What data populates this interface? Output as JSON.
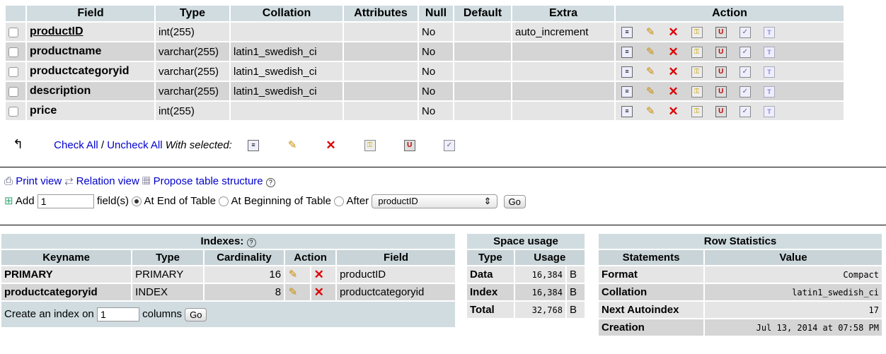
{
  "structure": {
    "headers": [
      "Field",
      "Type",
      "Collation",
      "Attributes",
      "Null",
      "Default",
      "Extra",
      "Action"
    ],
    "rows": [
      {
        "field": "productID",
        "type": "int(255)",
        "collation": "",
        "attributes": "",
        "null": "No",
        "default": "",
        "extra": "auto_increment"
      },
      {
        "field": "productname",
        "type": "varchar(255)",
        "collation": "latin1_swedish_ci",
        "attributes": "",
        "null": "No",
        "default": "",
        "extra": ""
      },
      {
        "field": "productcategoryid",
        "type": "varchar(255)",
        "collation": "latin1_swedish_ci",
        "attributes": "",
        "null": "No",
        "default": "",
        "extra": ""
      },
      {
        "field": "description",
        "type": "varchar(255)",
        "collation": "latin1_swedish_ci",
        "attributes": "",
        "null": "No",
        "default": "",
        "extra": ""
      },
      {
        "field": "price",
        "type": "int(255)",
        "collation": "",
        "attributes": "",
        "null": "No",
        "default": "",
        "extra": ""
      }
    ],
    "check_all": "Check All",
    "separator": "/",
    "uncheck_all": "Uncheck All",
    "with_selected": "With selected:"
  },
  "links": {
    "print_view": "Print view",
    "relation_view": "Relation view",
    "propose": "Propose table structure"
  },
  "add_field": {
    "add_label": "Add",
    "count": "1",
    "fields_label": "field(s)",
    "at_end": "At End of Table",
    "at_beginning": "At Beginning of Table",
    "after": "After",
    "after_select": "productID",
    "go": "Go"
  },
  "indexes": {
    "title": "Indexes:",
    "headers": [
      "Keyname",
      "Type",
      "Cardinality",
      "Action",
      "Field"
    ],
    "rows": [
      {
        "keyname": "PRIMARY",
        "type": "PRIMARY",
        "cardinality": "16",
        "field": "productID"
      },
      {
        "keyname": "productcategoryid",
        "type": "INDEX",
        "cardinality": "8",
        "field": "productcategoryid"
      }
    ],
    "create_prefix": "Create an index on",
    "create_count": "1",
    "create_suffix": "columns",
    "go": "Go"
  },
  "space": {
    "title": "Space usage",
    "headers": [
      "Type",
      "Usage"
    ],
    "rows": [
      {
        "type": "Data",
        "usage": "16,384",
        "unit": "B"
      },
      {
        "type": "Index",
        "usage": "16,384",
        "unit": "B"
      },
      {
        "type": "Total",
        "usage": "32,768",
        "unit": "B"
      }
    ]
  },
  "rowstats": {
    "title": "Row Statistics",
    "headers": [
      "Statements",
      "Value"
    ],
    "rows": [
      {
        "statement": "Format",
        "value": "Compact"
      },
      {
        "statement": "Collation",
        "value": "latin1_swedish_ci"
      },
      {
        "statement": "Next Autoindex",
        "value": "17"
      },
      {
        "statement": "Creation",
        "value": "Jul 13, 2014 at 07:58 PM"
      }
    ]
  },
  "icons": {
    "action_row": [
      "browse-icon",
      "edit-icon",
      "drop-icon",
      "primary-key-icon",
      "unique-icon",
      "index-icon",
      "fulltext-icon"
    ],
    "help": "help-icon"
  },
  "colors": {
    "header_bg": "#d0dce0",
    "row_light": "#e5e5e5",
    "row_dark": "#d5d5d5",
    "link": "#0000cc",
    "drop": "#dd0000"
  }
}
